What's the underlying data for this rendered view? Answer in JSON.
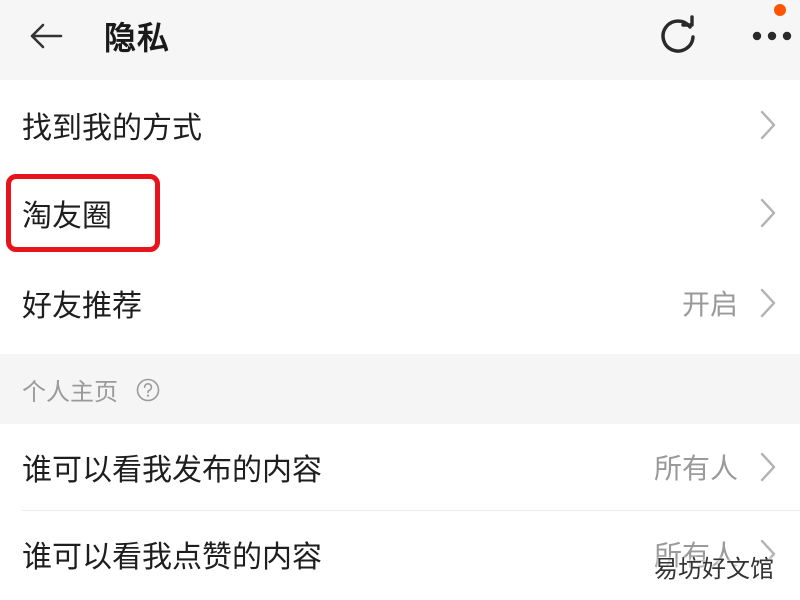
{
  "header": {
    "title": "隐私",
    "back_icon": "arrow-left-icon",
    "refresh_icon": "refresh-icon",
    "more_icon": "more-horizontal-icon",
    "notification_dot_color": "#ff5500"
  },
  "rows_top": [
    {
      "label": "找到我的方式",
      "value": ""
    },
    {
      "label": "淘友圈",
      "value": ""
    },
    {
      "label": "好友推荐",
      "value": "开启"
    }
  ],
  "section": {
    "label": "个人主页",
    "help_icon": "question-circle-icon"
  },
  "rows_profile": [
    {
      "label": "谁可以看我发布的内容",
      "value": "所有人"
    },
    {
      "label": "谁可以看我点赞的内容",
      "value": "所有人"
    }
  ],
  "highlight": {
    "color": "#e8141b",
    "target": "淘友圈"
  },
  "watermark": "易坊好文馆"
}
